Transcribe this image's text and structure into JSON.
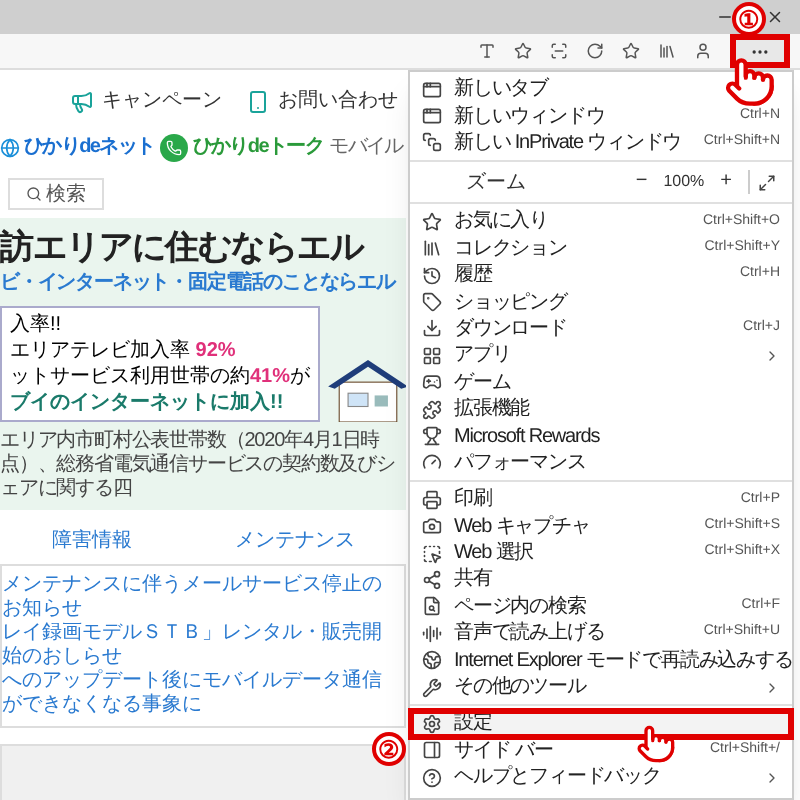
{
  "page": {
    "header_links": [
      "キャンペーン",
      "お問い合わせ"
    ],
    "services": [
      {
        "kind": "net",
        "label": "ひかりdeネット"
      },
      {
        "kind": "talk",
        "label": "ひかりdeトーク"
      },
      {
        "kind": "plain",
        "label": "モバイル"
      }
    ],
    "search_button": "検索",
    "banner": {
      "headline": "訪エリアに住むならエル",
      "subline": "ビ・インターネット・固定電話のことならエル",
      "badge_1": "入率!!",
      "stat_1": "エリアテレビ加入率",
      "value_1": "92%",
      "stat_2": "ットサービス利用世帯の約",
      "value_2": "41%",
      "stat_2_suffix": "が",
      "stat_3": "ブイのインターネットに加入!!",
      "footnote": "エリア内市町村公表世帯数（2020年4月1日時点）、総務省電気通信サービスの契約数及びシェアに関する四"
    },
    "tabs": [
      {
        "label": "障害情報",
        "selected": false
      },
      {
        "label": "メンテナンス",
        "selected": false
      }
    ],
    "news": [
      "メンテナンスに伴うメールサービス停止のお知らせ",
      "レイ録画モデルＳＴＢ」レンタル・販売開始のおしらせ",
      "へのアップデート後にモバイルデータ通信ができなくなる事象に"
    ]
  },
  "menu": {
    "items": [
      {
        "kind": "item",
        "label": "新しいタブ"
      },
      {
        "kind": "item",
        "label": "新しいウィンドウ",
        "shortcut": "Ctrl+N"
      },
      {
        "kind": "item",
        "label": "新しい InPrivate ウィンドウ",
        "shortcut": "Ctrl+Shift+N"
      },
      {
        "kind": "separator"
      },
      {
        "kind": "zoom",
        "label": "ズーム",
        "minus": "−",
        "value": "100%",
        "plus": "+"
      },
      {
        "kind": "separator"
      },
      {
        "kind": "item",
        "label": "お気に入り",
        "shortcut": "Ctrl+Shift+O"
      },
      {
        "kind": "item",
        "label": "コレクション",
        "shortcut": "Ctrl+Shift+Y"
      },
      {
        "kind": "item",
        "label": "履歴",
        "shortcut": "Ctrl+H"
      },
      {
        "kind": "item",
        "label": "ショッピング"
      },
      {
        "kind": "item",
        "label": "ダウンロード",
        "shortcut": "Ctrl+J"
      },
      {
        "kind": "item",
        "label": "アプリ",
        "submenu": true
      },
      {
        "kind": "item",
        "label": "ゲーム"
      },
      {
        "kind": "item",
        "label": "拡張機能"
      },
      {
        "kind": "item",
        "label": "Microsoft Rewards"
      },
      {
        "kind": "item",
        "label": "パフォーマンス"
      },
      {
        "kind": "separator"
      },
      {
        "kind": "item",
        "label": "印刷",
        "shortcut": "Ctrl+P"
      },
      {
        "kind": "item",
        "label": "Web キャプチャ",
        "shortcut": "Ctrl+Shift+S"
      },
      {
        "kind": "item",
        "label": "Web 選択",
        "shortcut": "Ctrl+Shift+X"
      },
      {
        "kind": "item",
        "label": "共有"
      },
      {
        "kind": "item",
        "label": "ページ内の検索",
        "shortcut": "Ctrl+F"
      },
      {
        "kind": "item",
        "label": "音声で読み上げる",
        "shortcut": "Ctrl+Shift+U"
      },
      {
        "kind": "item",
        "label": "Internet Explorer モードで再読み込みする"
      },
      {
        "kind": "item",
        "label": "その他のツール",
        "submenu": true
      },
      {
        "kind": "separator"
      },
      {
        "kind": "item",
        "label": "設定",
        "highlighted": true
      },
      {
        "kind": "item",
        "label": "サイド バー",
        "shortcut": "Ctrl+Shift+/"
      },
      {
        "kind": "item",
        "label": "ヘルプとフィードバック",
        "submenu": true
      }
    ]
  },
  "annotations": [
    {
      "number": "①"
    },
    {
      "number": "②"
    }
  ]
}
